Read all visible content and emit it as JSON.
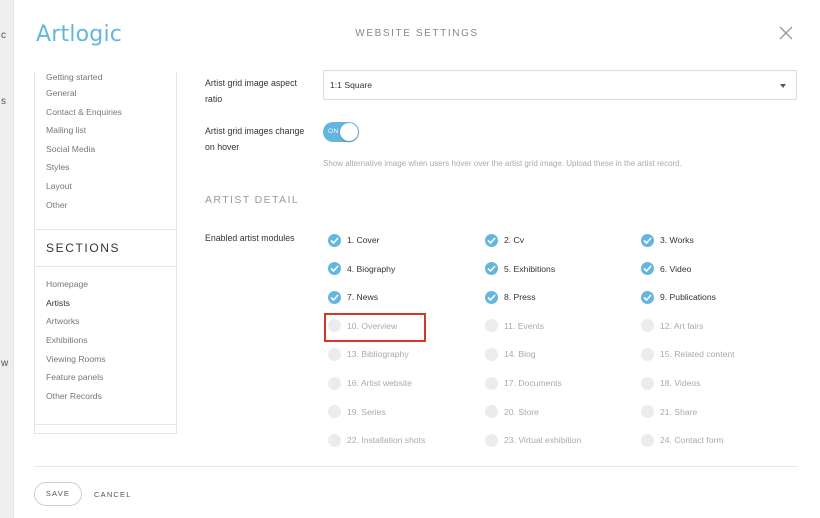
{
  "background_app": {
    "fragments": [
      "c",
      "s",
      "w"
    ]
  },
  "header": {
    "logo": "Artlogic",
    "title": "WEBSITE SETTINGS"
  },
  "sidebar": {
    "settings_items": [
      {
        "label": "Getting started"
      },
      {
        "label": "General"
      },
      {
        "label": "Contact & Enquiries"
      },
      {
        "label": "Mailing list"
      },
      {
        "label": "Social Media"
      },
      {
        "label": "Styles"
      },
      {
        "label": "Layout"
      },
      {
        "label": "Other"
      }
    ],
    "sections_heading": "SECTIONS",
    "section_items": [
      {
        "label": "Homepage",
        "active": false
      },
      {
        "label": "Artists",
        "active": true
      },
      {
        "label": "Artworks",
        "active": false
      },
      {
        "label": "Exhibitions",
        "active": false
      },
      {
        "label": "Viewing Rooms",
        "active": false
      },
      {
        "label": "Feature panels",
        "active": false
      },
      {
        "label": "Other Records",
        "active": false
      }
    ]
  },
  "main": {
    "aspect_ratio": {
      "label_line1": "Artist grid image aspect",
      "label_line2": "ratio",
      "value": "1:1 Square"
    },
    "hover_change": {
      "label_line1": "Artist grid images change",
      "label_line2": "on hover",
      "toggle_text": "ON",
      "enabled": true,
      "help": "Show alternative image when users hover over the artist grid image. Upload these in the artist record."
    },
    "artist_detail_heading": "ARTIST DETAIL",
    "modules_label": "Enabled artist modules",
    "modules": [
      {
        "label": "1. Cover",
        "checked": true
      },
      {
        "label": "2. Cv",
        "checked": true
      },
      {
        "label": "3. Works",
        "checked": true
      },
      {
        "label": "4. Biography",
        "checked": true
      },
      {
        "label": "5. Exhibitions",
        "checked": true
      },
      {
        "label": "6. Video",
        "checked": true
      },
      {
        "label": "7. News",
        "checked": true
      },
      {
        "label": "8. Press",
        "checked": true
      },
      {
        "label": "9. Publications",
        "checked": true
      },
      {
        "label": "10. Overview",
        "checked": false
      },
      {
        "label": "11. Events",
        "checked": false
      },
      {
        "label": "12. Art fairs",
        "checked": false
      },
      {
        "label": "13. Bibliography",
        "checked": false
      },
      {
        "label": "14. Blog",
        "checked": false
      },
      {
        "label": "15. Related content",
        "checked": false
      },
      {
        "label": "16. Artist website",
        "checked": false
      },
      {
        "label": "17. Documents",
        "checked": false
      },
      {
        "label": "18. Videos",
        "checked": false
      },
      {
        "label": "19. Series",
        "checked": false
      },
      {
        "label": "20. Store",
        "checked": false
      },
      {
        "label": "21. Share",
        "checked": false
      },
      {
        "label": "22. Installation shots",
        "checked": false
      },
      {
        "label": "23. Virtual exhibition",
        "checked": false
      },
      {
        "label": "24. Contact form",
        "checked": false
      }
    ]
  },
  "footer": {
    "save_label": "SAVE",
    "cancel_label": "CANCEL"
  },
  "colors": {
    "accent": "#64b6e0",
    "highlight": "#d9362b"
  }
}
